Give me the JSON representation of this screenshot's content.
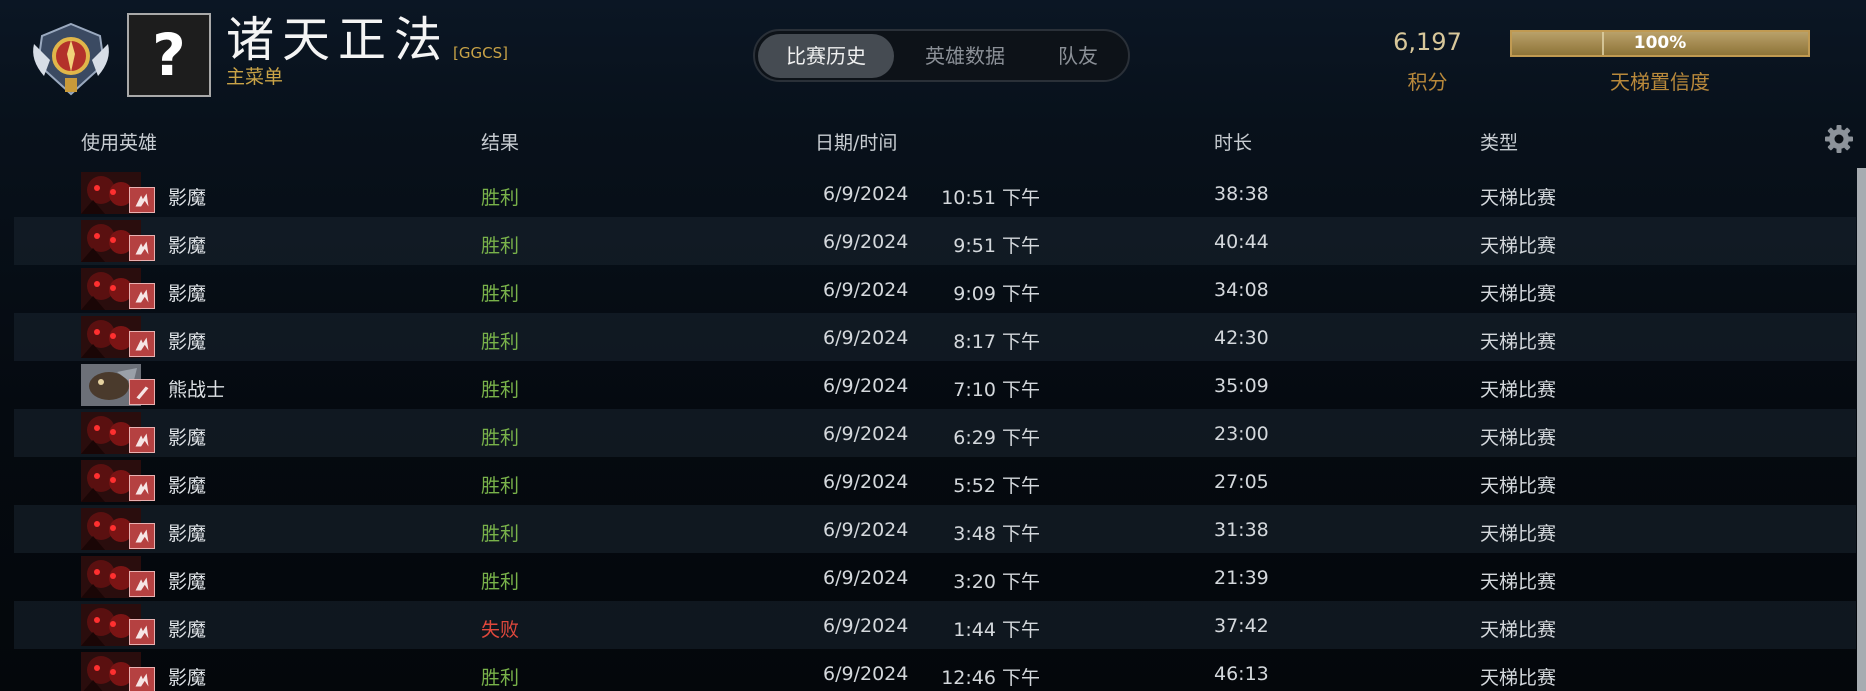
{
  "player": {
    "name": "诸天正法",
    "tag": "[GGCS]",
    "main_menu_label": "主菜单",
    "avatar_placeholder": "?"
  },
  "tabs": [
    {
      "label": "比赛历史",
      "active": true
    },
    {
      "label": "英雄数据",
      "active": false
    },
    {
      "label": "队友",
      "active": false
    }
  ],
  "rating": {
    "value": "6,197",
    "label": "积分"
  },
  "confidence": {
    "text": "100%",
    "level_percent": 100,
    "label": "天梯置信度"
  },
  "columns": {
    "hero": "使用英雄",
    "result": "结果",
    "datetime": "日期/时间",
    "duration": "时长",
    "type": "类型"
  },
  "icons": {
    "settings": "gear-icon",
    "rank_medal": "rank-medal-icon",
    "role_sf": "strength-role-icon",
    "role_ursa": "dagger-role-icon"
  },
  "colors": {
    "win": "#79b24a",
    "loss": "#e0483c",
    "gold": "#c9a347"
  },
  "matches": [
    {
      "hero": "影魔",
      "hero_key": "sf",
      "result": "胜利",
      "outcome": "win",
      "date": "6/9/2024",
      "time": "10:51 下午",
      "duration": "38:38",
      "type": "天梯比赛"
    },
    {
      "hero": "影魔",
      "hero_key": "sf",
      "result": "胜利",
      "outcome": "win",
      "date": "6/9/2024",
      "time": "9:51 下午",
      "duration": "40:44",
      "type": "天梯比赛"
    },
    {
      "hero": "影魔",
      "hero_key": "sf",
      "result": "胜利",
      "outcome": "win",
      "date": "6/9/2024",
      "time": "9:09 下午",
      "duration": "34:08",
      "type": "天梯比赛"
    },
    {
      "hero": "影魔",
      "hero_key": "sf",
      "result": "胜利",
      "outcome": "win",
      "date": "6/9/2024",
      "time": "8:17 下午",
      "duration": "42:30",
      "type": "天梯比赛"
    },
    {
      "hero": "熊战士",
      "hero_key": "ursa",
      "result": "胜利",
      "outcome": "win",
      "date": "6/9/2024",
      "time": "7:10 下午",
      "duration": "35:09",
      "type": "天梯比赛"
    },
    {
      "hero": "影魔",
      "hero_key": "sf",
      "result": "胜利",
      "outcome": "win",
      "date": "6/9/2024",
      "time": "6:29 下午",
      "duration": "23:00",
      "type": "天梯比赛"
    },
    {
      "hero": "影魔",
      "hero_key": "sf",
      "result": "胜利",
      "outcome": "win",
      "date": "6/9/2024",
      "time": "5:52 下午",
      "duration": "27:05",
      "type": "天梯比赛"
    },
    {
      "hero": "影魔",
      "hero_key": "sf",
      "result": "胜利",
      "outcome": "win",
      "date": "6/9/2024",
      "time": "3:48 下午",
      "duration": "31:38",
      "type": "天梯比赛"
    },
    {
      "hero": "影魔",
      "hero_key": "sf",
      "result": "胜利",
      "outcome": "win",
      "date": "6/9/2024",
      "time": "3:20 下午",
      "duration": "21:39",
      "type": "天梯比赛"
    },
    {
      "hero": "影魔",
      "hero_key": "sf",
      "result": "失败",
      "outcome": "loss",
      "date": "6/9/2024",
      "time": "1:44 下午",
      "duration": "37:42",
      "type": "天梯比赛"
    },
    {
      "hero": "影魔",
      "hero_key": "sf",
      "result": "胜利",
      "outcome": "win",
      "date": "6/9/2024",
      "time": "12:46 下午",
      "duration": "46:13",
      "type": "天梯比赛"
    }
  ]
}
